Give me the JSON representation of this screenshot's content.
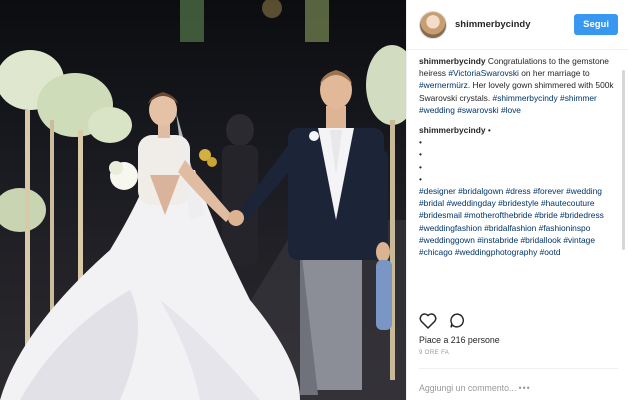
{
  "post": {
    "username": "shimmerbycindy",
    "follow_label": "Segui",
    "caption_user": "shimmerbycindy",
    "caption_parts": [
      {
        "t": " Congratulations to the gemstone heiress "
      },
      {
        "t": "#VictoriaSwarovski",
        "tag": true
      },
      {
        "t": " on her marriage to "
      },
      {
        "t": "#wernermürz",
        "tag": true
      },
      {
        "t": ". Her lovely gown shimmered with 500k Swarovski crystals. "
      },
      {
        "t": "#shimmerbycindy",
        "tag": true
      },
      {
        "t": " "
      },
      {
        "t": "#shimmer",
        "tag": true
      },
      {
        "t": " "
      },
      {
        "t": "#wedding",
        "tag": true
      },
      {
        "t": " "
      },
      {
        "t": "#swarovski",
        "tag": true
      },
      {
        "t": " "
      },
      {
        "t": "#love",
        "tag": true
      }
    ],
    "comment2_user": "shimmerbycindy",
    "comment2_suffix": " •",
    "comment2_dots": [
      "•",
      "•",
      "•",
      "•"
    ],
    "comment2_tags": "#designer #bridalgown #dress #forever #wedding #bridal #weddingday #bridestyle #hautecouture #bridesmail #motherofthebride #bride #bridedress #weddingfashion #bridalfashion #fashioninspo #weddinggown #instabride #bridallook #vintage #chicago #weddingphotography #ootd",
    "likes": "Piace a 216 persone",
    "time": "9 ORE FA",
    "add_comment_placeholder": "Aggiungi un commento...",
    "more_label": "•••"
  },
  "icons": {
    "like": "heart-icon",
    "comment": "comment-bubble-icon",
    "more": "more-options-icon"
  },
  "colors": {
    "follow_button": "#3897f0",
    "hashtag": "#003569"
  }
}
